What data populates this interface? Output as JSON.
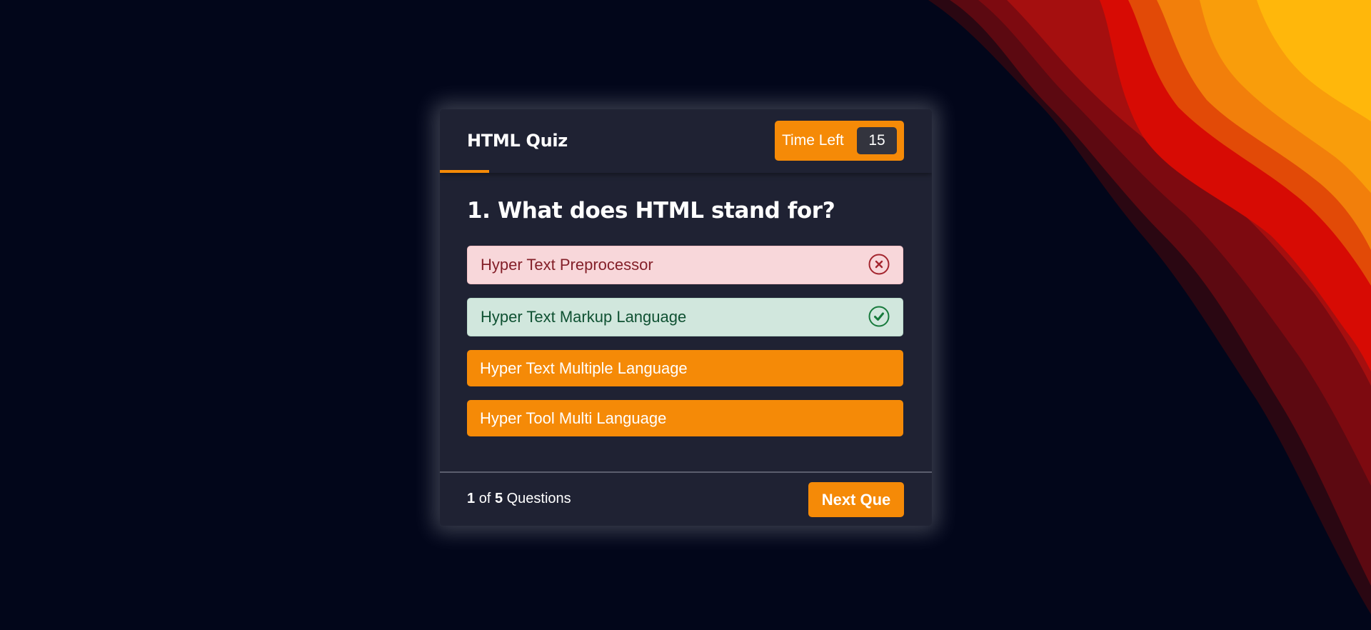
{
  "quiz": {
    "title": "HTML Quiz",
    "timer": {
      "label": "Time Left",
      "value": "15",
      "elapsed_fraction": 0.1
    },
    "question": "1. What does HTML stand for?",
    "options": [
      {
        "label": "Hyper Text Preprocessor",
        "state": "incorrect",
        "icon": "cross-circle-icon"
      },
      {
        "label": "Hyper Text Markup Language",
        "state": "correct",
        "icon": "check-circle-icon"
      },
      {
        "label": "Hyper Text Multiple Language",
        "state": "disabled"
      },
      {
        "label": "Hyper Tool Multi Language",
        "state": "disabled"
      }
    ],
    "footer": {
      "current": "1",
      "of_text": "of",
      "total": "5",
      "suffix": "Questions",
      "next_label": "Next Que"
    }
  },
  "colors": {
    "accent": "#f58a07",
    "card": "#1f2233",
    "background": "#02061a",
    "incorrect_bg": "#f8d7da",
    "correct_bg": "#d1e7dd"
  }
}
